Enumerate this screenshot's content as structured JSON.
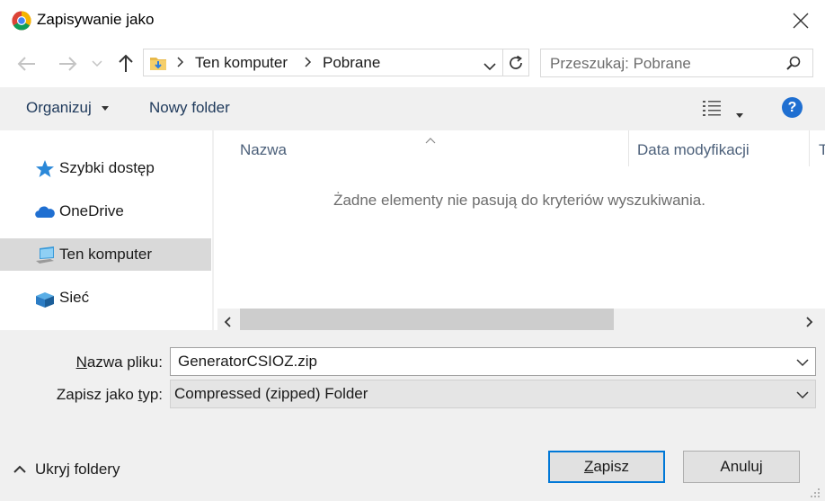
{
  "window": {
    "title": "Zapisywanie jako",
    "close_icon": "close-icon"
  },
  "address": {
    "crumbs": [
      "Ten komputer",
      "Pobrane"
    ]
  },
  "search": {
    "placeholder": "Przeszukaj: Pobrane"
  },
  "toolbar": {
    "organize_label": "Organizuj",
    "new_folder_label": "Nowy folder",
    "help_label": "?"
  },
  "sidebar": {
    "items": [
      {
        "label": "Szybki dostęp",
        "icon": "star-icon"
      },
      {
        "label": "OneDrive",
        "icon": "cloud-icon"
      },
      {
        "label": "Ten komputer",
        "icon": "computer-icon",
        "selected": true
      },
      {
        "label": "Sieć",
        "icon": "network-icon"
      }
    ]
  },
  "content": {
    "columns": [
      "Nazwa",
      "Data modyfikacji",
      "T"
    ],
    "empty_message": "Żadne elementy nie pasują do kryteriów wyszukiwania."
  },
  "form": {
    "filename_label_accel": "N",
    "filename_label_rest": "azwa pliku:",
    "filename_value": "GeneratorCSIOZ.zip",
    "type_label_start": "Zapisz jako ",
    "type_label_accel": "t",
    "type_label_rest": "yp:",
    "type_value": "Compressed (zipped) Folder"
  },
  "buttons": {
    "hide_folders_label": "Ukryj foldery",
    "save_accel": "Z",
    "save_rest": "apisz",
    "cancel_label": "Anuluj"
  },
  "colors": {
    "accent": "#0078d7",
    "selected_bg": "#d9d9d9",
    "panel_bg": "#f0f0f0"
  }
}
